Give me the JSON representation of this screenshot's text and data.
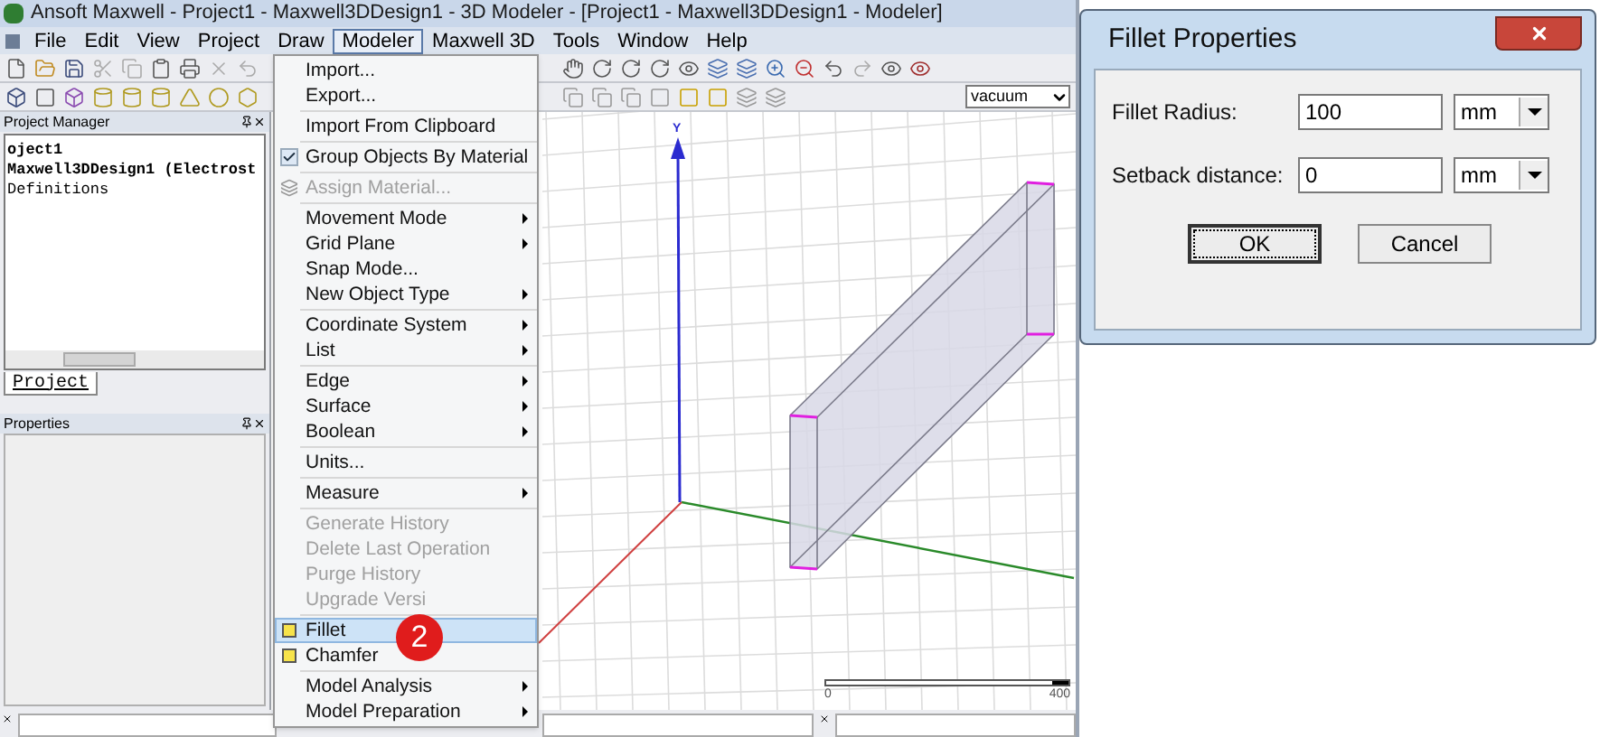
{
  "window": {
    "title": "Ansoft Maxwell - Project1 - Maxwell3DDesign1 - 3D Modeler - [Project1 - Maxwell3DDesign1 - Modeler]"
  },
  "menu_bar": [
    {
      "label": "File",
      "selected": false
    },
    {
      "label": "Edit",
      "selected": false
    },
    {
      "label": "View",
      "selected": false
    },
    {
      "label": "Project",
      "selected": false
    },
    {
      "label": "Draw",
      "selected": false
    },
    {
      "label": "Modeler",
      "selected": true
    },
    {
      "label": "Maxwell 3D",
      "selected": false
    },
    {
      "label": "Tools",
      "selected": false
    },
    {
      "label": "Window",
      "selected": false
    },
    {
      "label": "Help",
      "selected": false
    }
  ],
  "toolbar": {
    "material_dropdown": "vacuum"
  },
  "project_manager": {
    "title": "Project Manager",
    "items": [
      {
        "label": "oject1",
        "bold": true
      },
      {
        "label": "Maxwell3DDesign1 (Electrost",
        "bold": true
      },
      {
        "label": "Definitions",
        "bold": false
      }
    ],
    "tab": "Project"
  },
  "properties": {
    "title": "Properties"
  },
  "viewport": {
    "axis_label": "Y",
    "scale_start": "0",
    "scale_end": "400"
  },
  "modeler_menu": [
    {
      "kind": "item",
      "label": "Import...",
      "submenu": false,
      "disabled": false,
      "selected": false
    },
    {
      "kind": "item",
      "label": "Export...",
      "submenu": false,
      "disabled": false,
      "selected": false
    },
    {
      "kind": "separator"
    },
    {
      "kind": "item",
      "label": "Import From Clipboard",
      "submenu": false,
      "disabled": false,
      "selected": false
    },
    {
      "kind": "separator"
    },
    {
      "kind": "check",
      "label": "Group Objects By Material",
      "checked": true,
      "submenu": false,
      "disabled": false,
      "selected": false
    },
    {
      "kind": "separator"
    },
    {
      "kind": "material_item",
      "label": "Assign Material...",
      "submenu": false,
      "disabled": true,
      "selected": false
    },
    {
      "kind": "separator"
    },
    {
      "kind": "item",
      "label": "Movement Mode",
      "submenu": true,
      "disabled": false,
      "selected": false
    },
    {
      "kind": "item",
      "label": "Grid Plane",
      "submenu": true,
      "disabled": false,
      "selected": false
    },
    {
      "kind": "item",
      "label": "Snap Mode...",
      "submenu": false,
      "disabled": false,
      "selected": false
    },
    {
      "kind": "item",
      "label": "New Object Type",
      "submenu": true,
      "disabled": false,
      "selected": false
    },
    {
      "kind": "separator"
    },
    {
      "kind": "item",
      "label": "Coordinate System",
      "submenu": true,
      "disabled": false,
      "selected": false
    },
    {
      "kind": "item",
      "label": "List",
      "submenu": true,
      "disabled": false,
      "selected": false
    },
    {
      "kind": "separator"
    },
    {
      "kind": "item",
      "label": "Edge",
      "submenu": true,
      "disabled": false,
      "selected": false
    },
    {
      "kind": "item",
      "label": "Surface",
      "submenu": true,
      "disabled": false,
      "selected": false
    },
    {
      "kind": "item",
      "label": "Boolean",
      "submenu": true,
      "disabled": false,
      "selected": false
    },
    {
      "kind": "separator"
    },
    {
      "kind": "item",
      "label": "Units...",
      "submenu": false,
      "disabled": false,
      "selected": false
    },
    {
      "kind": "separator"
    },
    {
      "kind": "item",
      "label": "Measure",
      "submenu": true,
      "disabled": false,
      "selected": false
    },
    {
      "kind": "separator"
    },
    {
      "kind": "item",
      "label": "Generate History",
      "submenu": false,
      "disabled": true,
      "selected": false
    },
    {
      "kind": "item",
      "label": "Delete Last Operation",
      "submenu": false,
      "disabled": true,
      "selected": false
    },
    {
      "kind": "item",
      "label": "Purge History",
      "submenu": false,
      "disabled": true,
      "selected": false
    },
    {
      "kind": "item",
      "label": "Upgrade Versi",
      "submenu": false,
      "disabled": true,
      "selected": false
    },
    {
      "kind": "separator"
    },
    {
      "kind": "square_item",
      "label": "Fillet",
      "submenu": false,
      "disabled": false,
      "selected": true
    },
    {
      "kind": "square_item",
      "label": "Chamfer",
      "submenu": false,
      "disabled": false,
      "selected": false
    },
    {
      "kind": "separator"
    },
    {
      "kind": "item",
      "label": "Model Analysis",
      "submenu": true,
      "disabled": false,
      "selected": false
    },
    {
      "kind": "item",
      "label": "Model Preparation",
      "submenu": true,
      "disabled": false,
      "selected": false
    }
  ],
  "callout": "2",
  "dialog": {
    "title": "Fillet Properties",
    "fields": [
      {
        "label": "Fillet Radius:",
        "value": "100",
        "unit": "mm"
      },
      {
        "label": "Setback distance:",
        "value": "0",
        "unit": "mm"
      }
    ],
    "buttons": [
      {
        "label": "OK",
        "focused": true
      },
      {
        "label": "Cancel",
        "focused": false
      }
    ]
  }
}
